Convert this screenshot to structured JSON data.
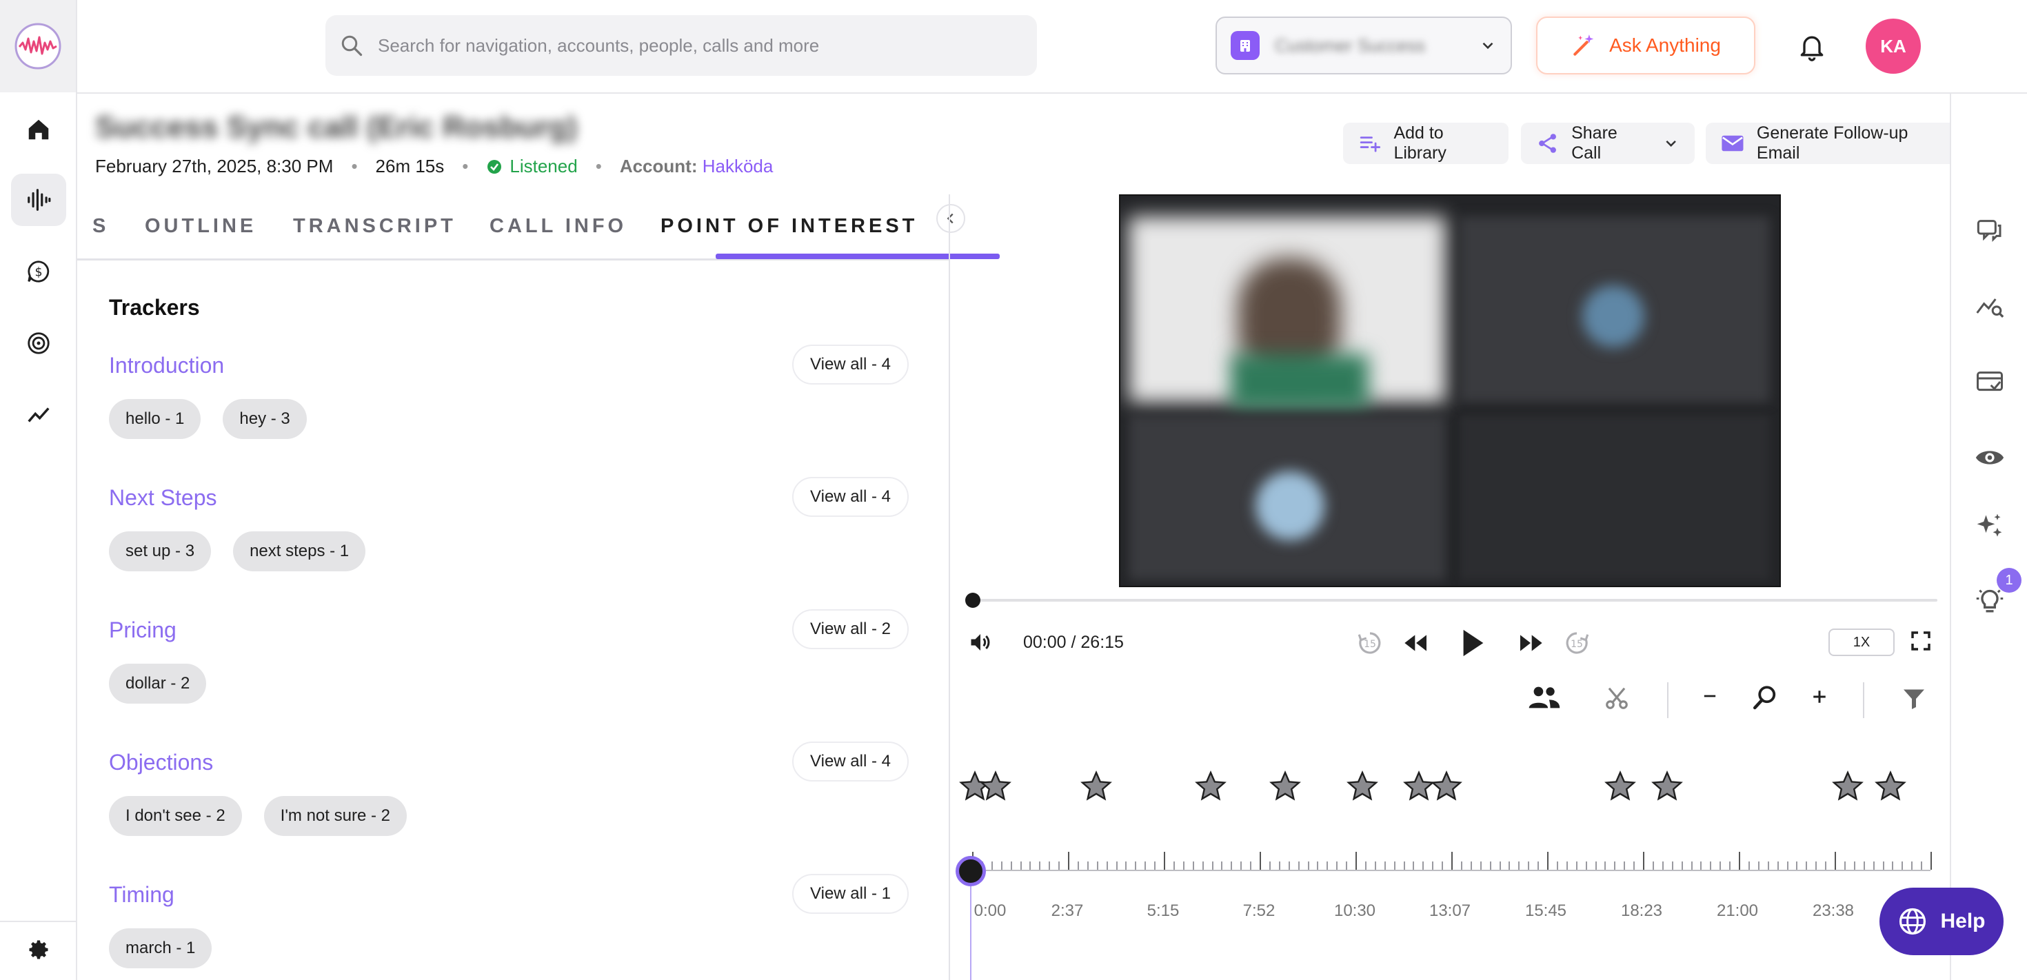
{
  "search": {
    "placeholder": "Search for navigation, accounts, people, calls and more"
  },
  "team_select": {
    "label": "Customer Success"
  },
  "ask_anything": {
    "label": "Ask Anything"
  },
  "user": {
    "initials": "KA"
  },
  "call": {
    "title": "Success Sync call (Eric Rosburg)",
    "date": "February 27th, 2025, 8:30 PM",
    "duration": "26m 15s",
    "status": "Listened",
    "account_label": "Account:",
    "account_name": "Hakköda"
  },
  "header_actions": {
    "add_to_library": "Add to Library",
    "share_call": "Share Call",
    "generate_email": "Generate Follow-up Email"
  },
  "tabs": [
    {
      "label": "S"
    },
    {
      "label": "OUTLINE"
    },
    {
      "label": "TRANSCRIPT"
    },
    {
      "label": "CALL INFO"
    },
    {
      "label": "POINT OF INTEREST",
      "active": true
    }
  ],
  "trackers": {
    "title": "Trackers",
    "items": [
      {
        "name": "Introduction",
        "view_all": "View all - 4",
        "chips": [
          "hello - 1",
          "hey - 3"
        ]
      },
      {
        "name": "Next Steps",
        "view_all": "View all - 4",
        "chips": [
          "set up - 3",
          "next steps - 1"
        ]
      },
      {
        "name": "Pricing",
        "view_all": "View all - 2",
        "chips": [
          "dollar - 2"
        ]
      },
      {
        "name": "Objections",
        "view_all": "View all - 4",
        "chips": [
          "I don't see - 2",
          "I'm not sure - 2"
        ]
      },
      {
        "name": "Timing",
        "view_all": "View all - 1",
        "chips": [
          "march - 1"
        ]
      }
    ]
  },
  "player": {
    "time": "00:00 / 26:15",
    "speed": "1X",
    "progress": 0
  },
  "timeline": {
    "labels": [
      "0:00",
      "2:37",
      "5:15",
      "7:52",
      "10:30",
      "13:07",
      "15:45",
      "18:23",
      "21:00",
      "23:38"
    ]
  },
  "right_rail": {
    "badge": "1"
  },
  "help": {
    "label": "Help"
  },
  "colors": {
    "accent": "#8b6cf0",
    "brand_dark": "#4b2bb3",
    "ask": "#ff5a1f",
    "avatar": "#f24a8a",
    "listened": "#22a34a"
  }
}
